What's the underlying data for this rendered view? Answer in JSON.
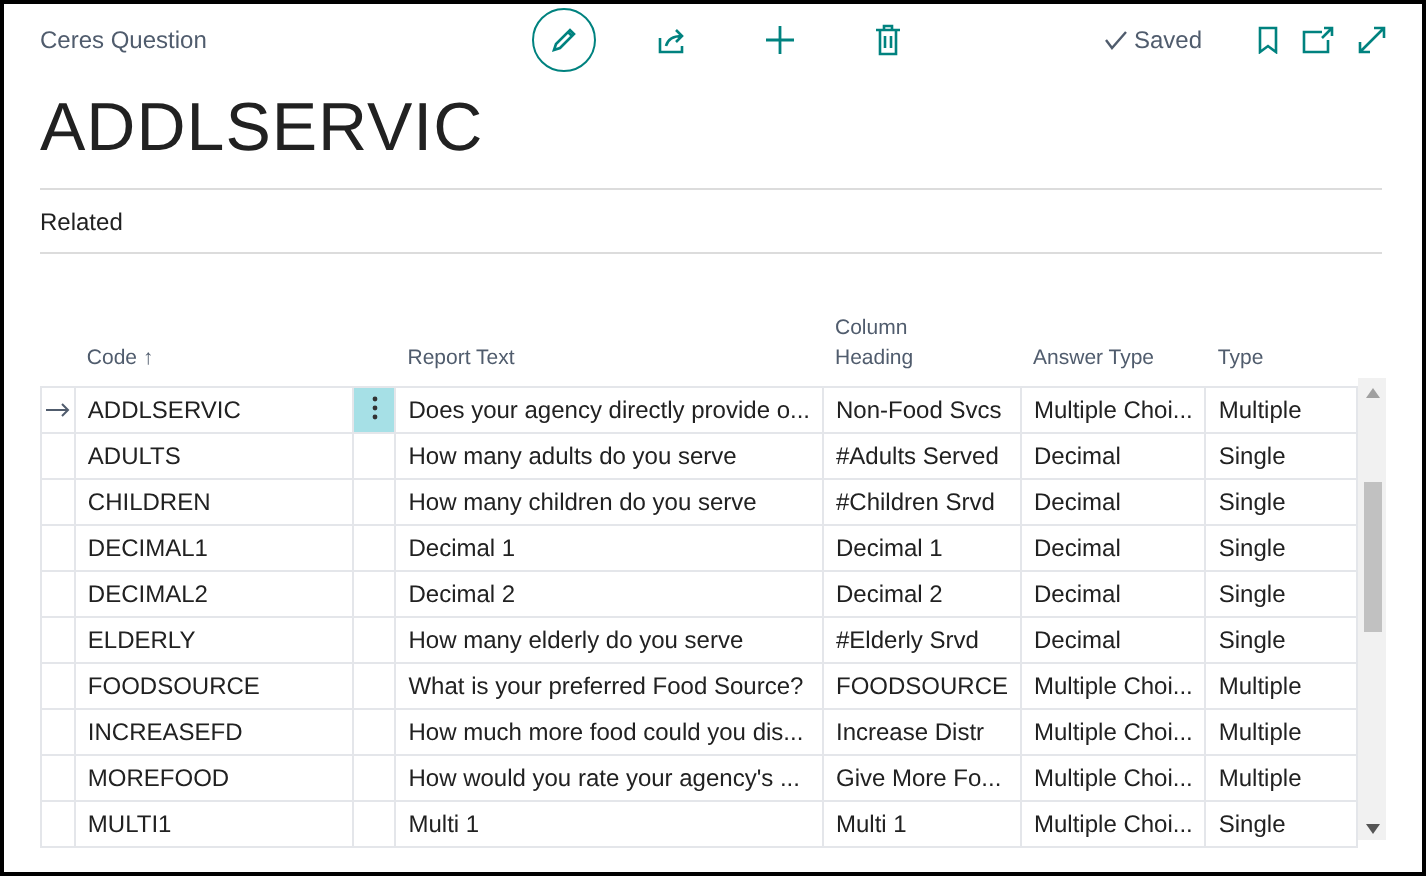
{
  "header": {
    "caption": "Ceres Question",
    "title": "ADDLSERVIC",
    "status": "Saved",
    "actions": [
      {
        "kind": "edit",
        "selected": true
      },
      {
        "kind": "share",
        "selected": false
      },
      {
        "kind": "new",
        "selected": false
      },
      {
        "kind": "delete",
        "selected": false
      }
    ]
  },
  "related": "Related",
  "table": {
    "columns": [
      {
        "label": "Code",
        "sort": "↑"
      },
      {
        "label": "Report Text"
      },
      {
        "label": "Column Heading"
      },
      {
        "label": "Answer Type"
      },
      {
        "label": "Type"
      }
    ],
    "rows": [
      {
        "selected": true,
        "cells": [
          "ADDLSERVIC",
          "Does your agency directly provide o...",
          "Non-Food Svcs",
          "Multiple Choi...",
          "Multiple"
        ]
      },
      {
        "selected": false,
        "cells": [
          "ADULTS",
          "How many adults do you serve",
          "#Adults Served",
          "Decimal",
          "Single"
        ]
      },
      {
        "selected": false,
        "cells": [
          "CHILDREN",
          "How many children do you serve",
          "#Children Srvd",
          "Decimal",
          "Single"
        ]
      },
      {
        "selected": false,
        "cells": [
          "DECIMAL1",
          "Decimal 1",
          "Decimal 1",
          "Decimal",
          "Single"
        ]
      },
      {
        "selected": false,
        "cells": [
          "DECIMAL2",
          "Decimal 2",
          "Decimal 2",
          "Decimal",
          "Single"
        ]
      },
      {
        "selected": false,
        "cells": [
          "ELDERLY",
          "How many elderly do you serve",
          "#Elderly Srvd",
          "Decimal",
          "Single"
        ]
      },
      {
        "selected": false,
        "cells": [
          "FOODSOURCE",
          "What is your preferred Food Source?",
          "FOODSOURCE",
          "Multiple Choi...",
          "Multiple"
        ]
      },
      {
        "selected": false,
        "cells": [
          "INCREASEFD",
          "How much more food could you dis...",
          "Increase Distr",
          "Multiple Choi...",
          "Multiple"
        ]
      },
      {
        "selected": false,
        "cells": [
          "MOREFOOD",
          "How would you rate your agency's ...",
          "Give More Fo...",
          "Multiple Choi...",
          "Multiple"
        ]
      },
      {
        "selected": false,
        "cells": [
          "MULTI1",
          "Multi 1",
          "Multi 1",
          "Multiple Choi...",
          "Single"
        ]
      }
    ]
  }
}
